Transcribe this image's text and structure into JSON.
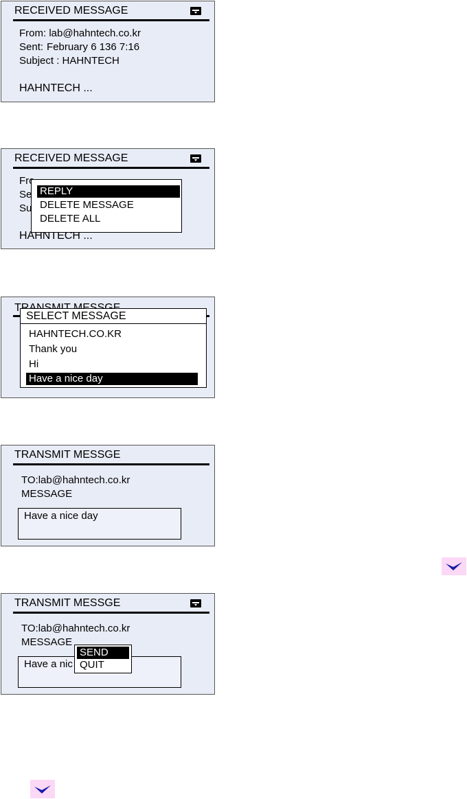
{
  "screens": [
    {
      "title": "RECEIVED MESSAGE",
      "from": "From: lab@hahntech.co.kr",
      "sent_label": "Sent:",
      "sent_value": "February 6 136 7:16",
      "subject": "Subject : HAHNTECH",
      "body": "HAHNTECH ...",
      "icon": "card-icon"
    },
    {
      "title": "RECEIVED MESSAGE",
      "partial_from": "Fro",
      "partial_sent": "Se",
      "partial_subject": "Su",
      "body": "HAHNTECH ...",
      "icon": "card-icon",
      "menu": [
        "REPLY",
        "DELETE MESSAGE",
        "DELETE ALL"
      ],
      "selected": "REPLY"
    },
    {
      "title": "TRANSMIT MESSGE",
      "popup_title": "SELECT MESSAGE",
      "options": [
        "HAHNTECH.CO.KR",
        "Thank you",
        "Hi",
        "Have a nice day"
      ],
      "selected": "Have a nice day"
    },
    {
      "title": "TRANSMIT MESSGE",
      "to": "TO:lab@hahntech.co.kr",
      "message_label": "MESSAGE",
      "message_text": "Have a nice day"
    },
    {
      "title": "TRANSMIT MESSGE",
      "to": "TO:lab@hahntech.co.kr",
      "message_label": "MESSAGE",
      "message_text_partial": "Have a nic",
      "icon": "card-icon",
      "menu": [
        "SEND",
        "QUIT"
      ],
      "selected": "SEND"
    }
  ],
  "check_icon": "checkmark-icon",
  "colors": {
    "screen_bg": "#e8ecf6",
    "check_bg": "#fbd8f6",
    "check_fg": "#1a1aa8"
  }
}
